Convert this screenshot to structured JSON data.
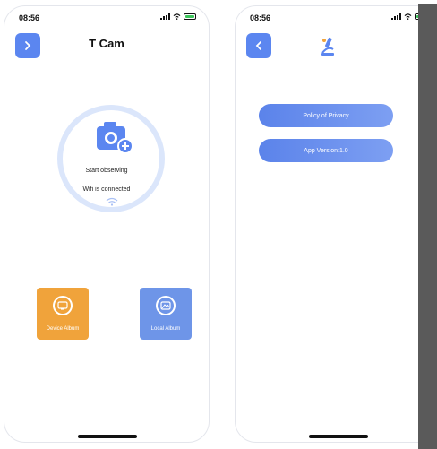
{
  "status_bar": {
    "time": "08:56"
  },
  "screen1": {
    "title": "T Cam",
    "start_text": "Start observing",
    "wifi_text": "Wifi is connected",
    "device_album_label": "Device Album",
    "local_album_label": "Local Album"
  },
  "screen2": {
    "privacy_label": "Policy of Privacy",
    "version_label": "App Version:1.0"
  },
  "colors": {
    "accent": "#5b86f0",
    "device_album": "#f0a33b",
    "local_album": "#6e95e8",
    "ring": "#dbe6fb"
  },
  "icons": [
    "chevron-right-icon",
    "camera-add-icon",
    "wifi-icon",
    "device-album-icon",
    "local-album-icon",
    "chevron-left-icon",
    "microscope-logo-icon"
  ]
}
